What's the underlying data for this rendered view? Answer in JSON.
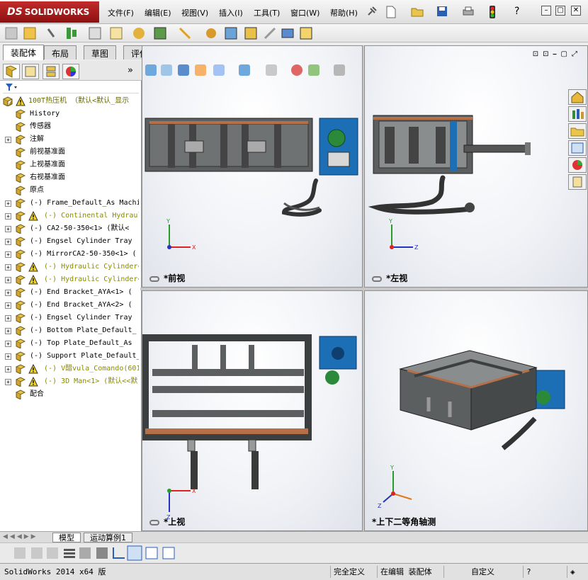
{
  "app": {
    "brand": "SOLIDWORKS",
    "brand_prefix": "DS"
  },
  "menu": [
    "文件(F)",
    "编辑(E)",
    "视图(V)",
    "插入(I)",
    "工具(T)",
    "窗口(W)",
    "帮助(H)"
  ],
  "command_tabs": [
    "装配体",
    "布局",
    "草图",
    "评估"
  ],
  "feature_tree": {
    "root": "100T热压机  （默认<默认_显示",
    "items": [
      {
        "label": "History",
        "expand": false,
        "warn": false
      },
      {
        "label": "传感器",
        "expand": false,
        "warn": false
      },
      {
        "label": "注解",
        "expand": true,
        "warn": false
      },
      {
        "label": "前视基准面",
        "expand": false,
        "warn": false
      },
      {
        "label": "上视基准面",
        "expand": false,
        "warn": false
      },
      {
        "label": "右视基准面",
        "expand": false,
        "warn": false
      },
      {
        "label": "原点",
        "expand": false,
        "warn": false
      },
      {
        "label": "(-) Frame_Default_As Machi",
        "expand": true,
        "warn": false
      },
      {
        "label": "(-) Continental Hydraul",
        "expand": true,
        "warn": true
      },
      {
        "label": "(-) CA2-50-350<1> (默认<",
        "expand": true,
        "warn": false
      },
      {
        "label": "(-) Engsel Cylinder Tray ",
        "expand": true,
        "warn": false
      },
      {
        "label": "(-) MirrorCA2-50-350<1> (",
        "expand": true,
        "warn": false
      },
      {
        "label": "(-) Hydraulic Cylinder<",
        "expand": true,
        "warn": true
      },
      {
        "label": "(-) Hydraulic Cylinder<",
        "expand": true,
        "warn": true
      },
      {
        "label": "(-) End Bracket_AYA<1> (",
        "expand": true,
        "warn": false
      },
      {
        "label": "(-) End Bracket_AYA<2> (",
        "expand": true,
        "warn": false
      },
      {
        "label": "(-) Engsel Cylinder Tray ",
        "expand": true,
        "warn": false
      },
      {
        "label": "(-) Bottom Plate_Default_",
        "expand": true,
        "warn": false
      },
      {
        "label": "(-) Top Plate_Default_As ",
        "expand": true,
        "warn": false
      },
      {
        "label": "(-) Support Plate_Default_",
        "expand": true,
        "warn": false
      },
      {
        "label": "(-) V醋vula_Comando(601",
        "expand": true,
        "warn": true
      },
      {
        "label": "(-) 3D Man<1> (默认<<默",
        "expand": true,
        "warn": true
      },
      {
        "label": "配合",
        "expand": false,
        "warn": false
      }
    ]
  },
  "viewports": {
    "front": "*前视",
    "left": "*左视",
    "top": "*上视",
    "iso": "*上下二等角轴测"
  },
  "axis_labels": {
    "x": "X",
    "y": "Y",
    "z": "Z"
  },
  "bottom_tabs": [
    "模型",
    "运动算例1"
  ],
  "status": {
    "version": "SolidWorks 2014 x64 版",
    "definition": "完全定义",
    "editing": "在编辑 装配体",
    "units": "自定义"
  },
  "colors": {
    "frame": "#5b5f5f",
    "frame_dark": "#3c3f40",
    "plate": "#b5704a",
    "hydraulic_blue": "#1c6fb5",
    "motor_green": "#2a8a3a",
    "title_red": "#b01e1e"
  }
}
